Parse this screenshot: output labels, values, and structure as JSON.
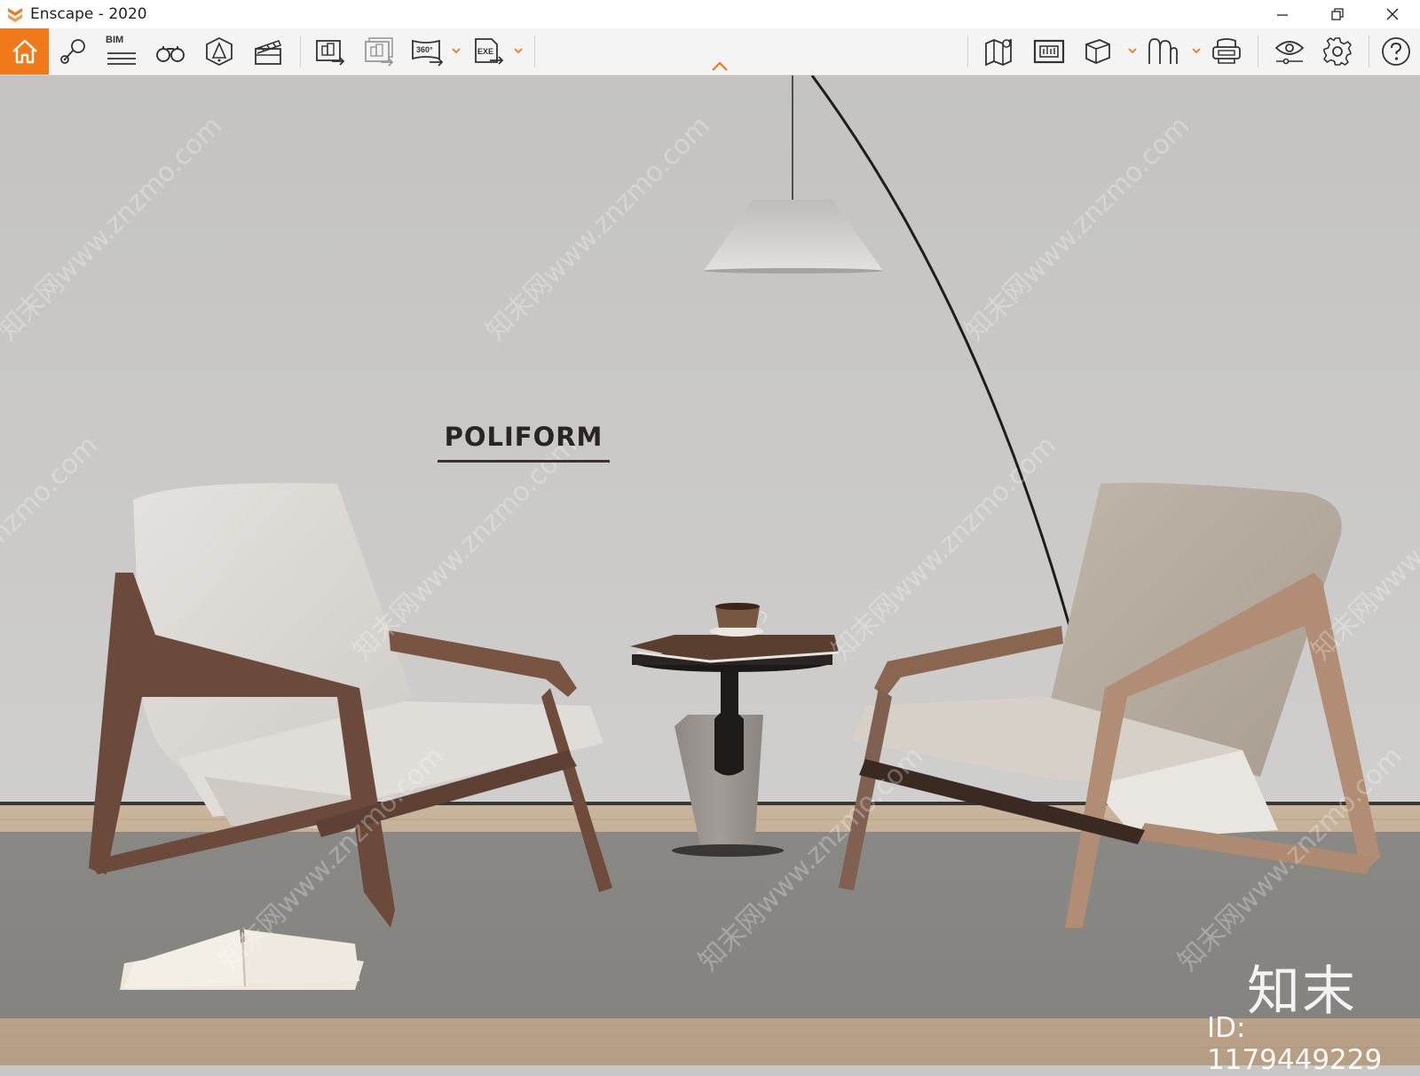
{
  "window": {
    "title": "Enscape - 2020",
    "accent_color": "#f07a1a"
  },
  "toolbar": {
    "left_buttons": [
      {
        "name": "home-icon",
        "tooltip": ""
      },
      {
        "name": "map-pin-icon",
        "tooltip": ""
      },
      {
        "name": "bim-icon",
        "label": "BIM"
      },
      {
        "name": "binoculars-icon"
      },
      {
        "name": "sun-lamp-icon"
      },
      {
        "name": "clapperboard-icon"
      },
      {
        "name": "screenshot-export-icon"
      },
      {
        "name": "batch-export-icon"
      },
      {
        "name": "panorama-360-icon",
        "label": "360°"
      },
      {
        "name": "exe-export-icon",
        "label": "EXE"
      }
    ],
    "right_buttons": [
      {
        "name": "map-view-icon"
      },
      {
        "name": "material-library-icon"
      },
      {
        "name": "cube-view-icon"
      },
      {
        "name": "asset-library-icon"
      },
      {
        "name": "vr-headset-icon"
      },
      {
        "name": "visual-settings-icon"
      },
      {
        "name": "gear-icon"
      },
      {
        "name": "help-icon"
      }
    ]
  },
  "scene": {
    "brand_sign": "POLIFORM",
    "watermark_text": "知末网www.znzmo.com",
    "watermark_logo": "知末",
    "watermark_id": "ID: 1179449229",
    "wall_color": "#c9c8c6",
    "floor_color": "#bfa88e",
    "rug_color": "#8e8c88"
  }
}
